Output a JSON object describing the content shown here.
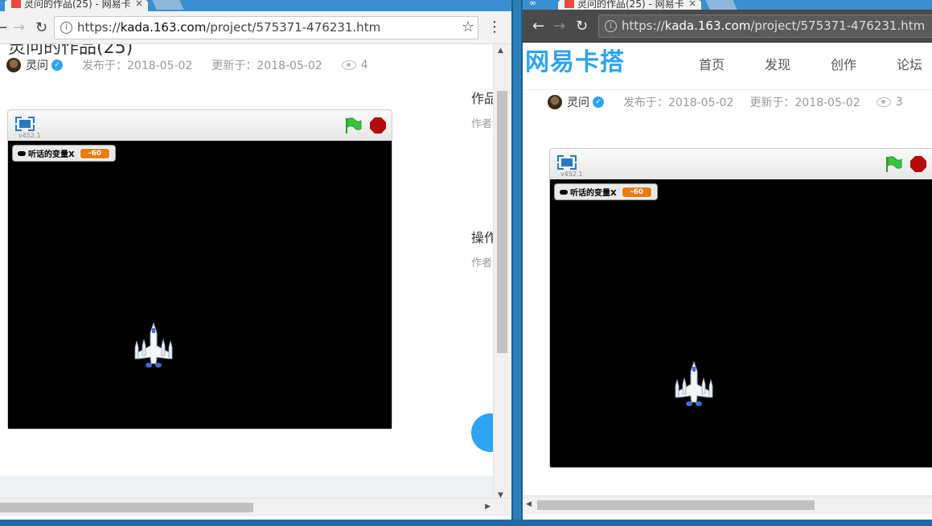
{
  "left_window": {
    "tab_title": "灵问的作品(25) - 网易卡",
    "url_host": "kada.163.com",
    "url_path": "/project/575371-476231.htm",
    "url_scheme": "https://",
    "title_partial": "灵问的作品(25)",
    "author": "灵问",
    "published": "发布于：2018-05-02",
    "updated": "更新于：2018-05-02",
    "views": "4",
    "player_version": "v452.1",
    "variable_label": "听话的变量X",
    "variable_value": "-60",
    "sidebar_heading_1": "作品",
    "sidebar_sub_1": "作者:",
    "sidebar_heading_2": "操作",
    "sidebar_sub_2": "作者:"
  },
  "right_window": {
    "tab_title": "灵问的作品(25) - 网易卡",
    "url_host": "kada.163.com",
    "url_path": "/project/575371-476231.htm",
    "url_scheme": "https://",
    "site_logo": "网易卡搭",
    "nav": [
      "首页",
      "发现",
      "创作",
      "论坛"
    ],
    "author": "灵问",
    "published": "发布于：2018-05-02",
    "updated": "更新于：2018-05-02",
    "views": "3",
    "player_version": "v452.1",
    "variable_label": "听话的变量X",
    "variable_value": "-60"
  },
  "icons": {
    "info": "i",
    "star": "☆",
    "menu": "⋮",
    "back": "←",
    "forward": "→",
    "reload": "↻",
    "tab_close": "×"
  },
  "colors": {
    "brand": "#2ea3f2",
    "stop": "#b30d0d",
    "flag": "#3cc23c",
    "variable": "#ea7c13"
  }
}
